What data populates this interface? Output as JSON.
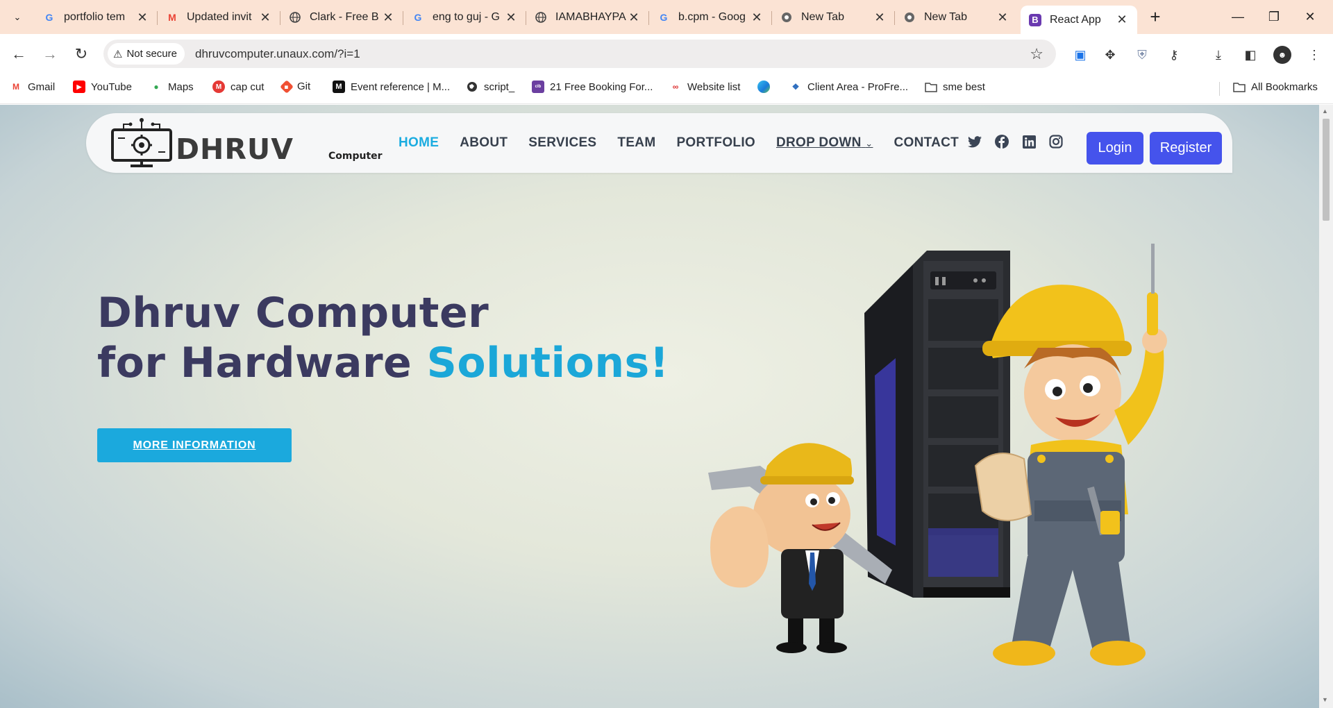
{
  "browser": {
    "tabs": [
      {
        "title": "portfolio tem",
        "icon": "google-icon"
      },
      {
        "title": "Updated invit",
        "icon": "gmail-icon"
      },
      {
        "title": "Clark - Free B",
        "icon": "globe-icon"
      },
      {
        "title": "eng to guj - G",
        "icon": "google-icon"
      },
      {
        "title": "IAMABHAYPA",
        "icon": "globe-icon"
      },
      {
        "title": "b.cpm - Goog",
        "icon": "google-icon"
      },
      {
        "title": "New Tab",
        "icon": "chrome-icon"
      },
      {
        "title": "New Tab",
        "icon": "chrome-icon"
      },
      {
        "title": "React App",
        "icon": "bootstrap-icon",
        "active": true
      }
    ],
    "security_label": "Not secure",
    "url": "dhruvcomputer.unaux.com/?i=1",
    "bookmarks": [
      {
        "label": "Gmail",
        "icon": "gmail-icon"
      },
      {
        "label": "YouTube",
        "icon": "youtube-icon"
      },
      {
        "label": "Maps",
        "icon": "maps-icon"
      },
      {
        "label": "cap cut",
        "icon": "capcut-icon"
      },
      {
        "label": "Git",
        "icon": "git-icon"
      },
      {
        "label": "Event reference | M...",
        "icon": "mdn-icon"
      },
      {
        "label": "script_",
        "icon": "globe-icon"
      },
      {
        "label": "21 Free Booking For...",
        "icon": "colorlib-icon"
      },
      {
        "label": "Website list",
        "icon": "website-list-icon"
      },
      {
        "label": "",
        "icon": "edge-icon"
      },
      {
        "label": "Client Area - ProFre...",
        "icon": "profreehost-icon"
      },
      {
        "label": "sme best",
        "icon": "folder-icon"
      }
    ],
    "all_bookmarks": "All Bookmarks"
  },
  "site": {
    "logo_word": "DHRUV",
    "logo_sub": "Computer",
    "nav": [
      "HOME",
      "ABOUT",
      "SERVICES",
      "TEAM",
      "PORTFOLIO",
      "DROP DOWN",
      "CONTACT"
    ],
    "socials": [
      "twitter-icon",
      "facebook-icon",
      "linkedin-icon",
      "instagram-icon"
    ],
    "login": "Login",
    "register": "Register",
    "hero_line1": "Dhruv Computer",
    "hero_line2_prefix": "for Hardware ",
    "hero_line2_accent": "Solutions!",
    "cta": "MORE INFORMATION"
  },
  "colors": {
    "accent": "#1ba9dd",
    "button": "#4553ec",
    "heading": "#3b3a60",
    "tabstrip": "#fbe3d4"
  }
}
